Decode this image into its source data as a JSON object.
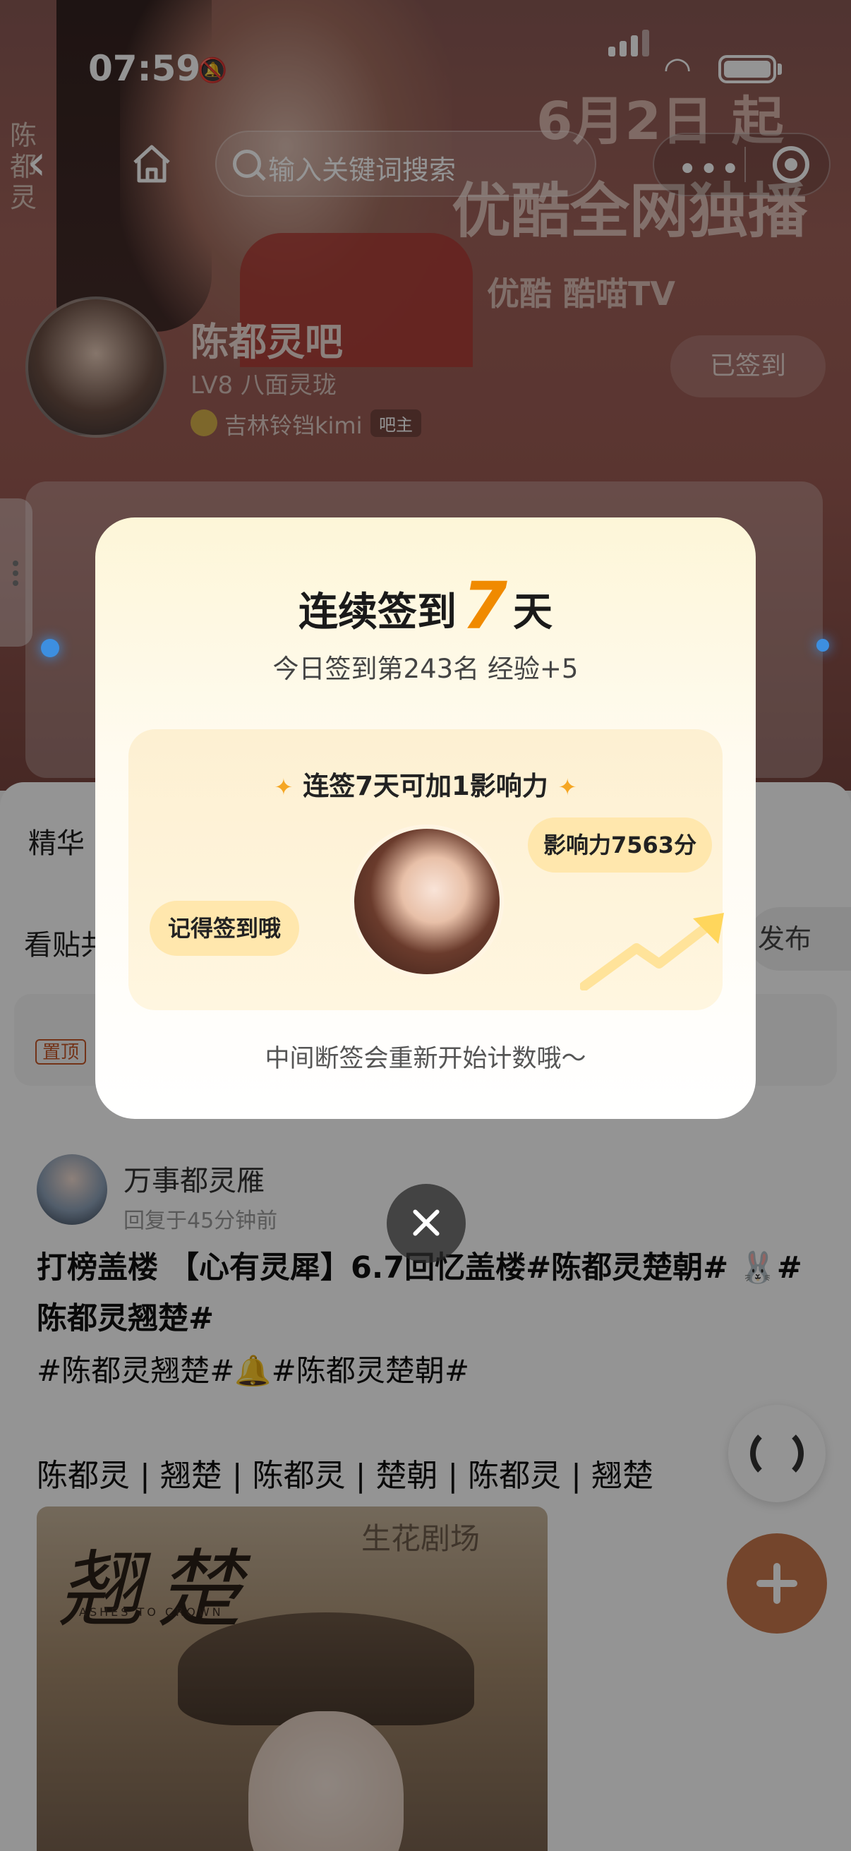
{
  "status_bar": {
    "time": "07:59"
  },
  "nav": {
    "search_placeholder": "输入关键词搜索",
    "more_icon": "more-dots-icon",
    "close_mini_icon": "target-icon"
  },
  "hero": {
    "vertical_title": "陈都灵",
    "promo_date": "6月2日 起",
    "promo_line": "优酷全网独播",
    "promo_platforms": "优酷  酷喵TV"
  },
  "forum": {
    "name": "陈都灵吧",
    "level": "LV8 八面灵珑",
    "owner_name": "吉林铃铛kimi",
    "owner_badge": "吧主",
    "sign_button": "已签到"
  },
  "tabs": {
    "featured": "精华",
    "view_posts": "看贴共",
    "publish": "发布"
  },
  "pinned": {
    "badge": "置顶"
  },
  "post": {
    "author": "万事都灵雁",
    "time": "回复于45分钟前",
    "title": "打榜盖楼 【心有灵犀】6.7回忆盖楼#陈都灵楚朝# 🐰#陈都灵翘楚#",
    "line2": "#陈都灵翘楚#🔔#陈都灵楚朝#",
    "tags": "陈都灵 | 翘楚 | 陈都灵 | 楚朝 | 陈都灵 | 翘楚",
    "image_title": "翘楚",
    "image_subtitle": "ASHES TO CROWN",
    "image_brand": "生花剧场"
  },
  "checkin_modal": {
    "title_prefix": "连续签到",
    "streak_days": "7",
    "title_suffix": "天",
    "subtitle": "今日签到第243名 经验+5",
    "bonus_text": "连签7天可加1影响力",
    "bubble_left": "记得签到哦",
    "bubble_right": "影响力7563分",
    "note": "中间断签会重新开始计数哦～"
  },
  "colors": {
    "accent_orange": "#f08a00",
    "fab_brown": "#c9774c",
    "bubble_yellow": "#ffe7ad"
  }
}
